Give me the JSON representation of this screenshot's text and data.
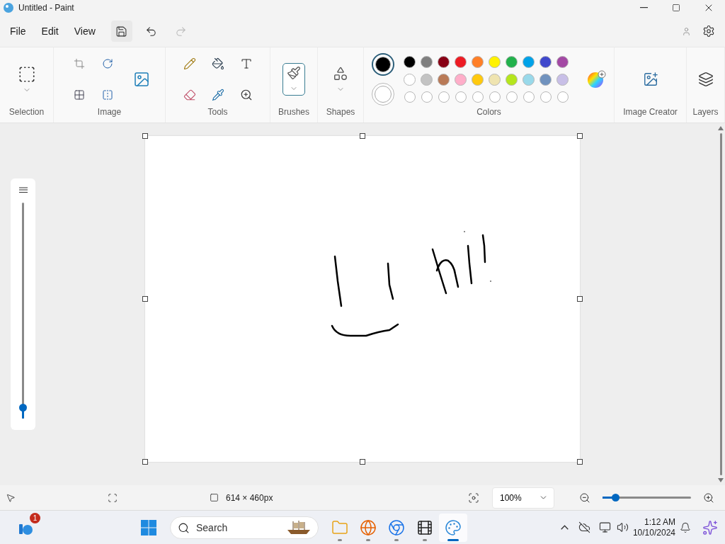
{
  "window": {
    "title": "Untitled - Paint"
  },
  "menu": [
    {
      "label": "File"
    },
    {
      "label": "Edit"
    },
    {
      "label": "View"
    }
  ],
  "ribbon": {
    "groups": [
      {
        "kind": "selection",
        "label": "Selection",
        "selected": false
      },
      {
        "kind": "image",
        "label": "Image"
      },
      {
        "kind": "tools",
        "label": "Tools"
      },
      {
        "kind": "brushes",
        "label": "Brushes",
        "selected": true
      },
      {
        "kind": "shapes",
        "label": "Shapes",
        "selected": false
      },
      {
        "kind": "colors",
        "label": "Colors"
      },
      {
        "kind": "creator",
        "label": "Image Creator"
      },
      {
        "kind": "layers",
        "label": "Layers"
      }
    ],
    "primary_color": {
      "color": "#000000",
      "selected": true
    },
    "secondary_color": {
      "color": "#ffffff",
      "selected": false
    },
    "palette": [
      {
        "color": "#000000"
      },
      {
        "color": "#7f7f7f"
      },
      {
        "color": "#880015"
      },
      {
        "color": "#ed1c24"
      },
      {
        "color": "#ff7f27"
      },
      {
        "color": "#fff200"
      },
      {
        "color": "#22b14c"
      },
      {
        "color": "#00a2e8"
      },
      {
        "color": "#3f48cc"
      },
      {
        "color": "#a349a4"
      },
      {
        "color": "#ffffff"
      },
      {
        "color": "#c3c3c3"
      },
      {
        "color": "#b97a57"
      },
      {
        "color": "#ffaec9"
      },
      {
        "color": "#ffc90e"
      },
      {
        "color": "#efe4b0"
      },
      {
        "color": "#b5e61d"
      },
      {
        "color": "#99d9ea"
      },
      {
        "color": "#7092be"
      },
      {
        "color": "#c8bfe7"
      }
    ]
  },
  "size_slider": {
    "level": 0.05
  },
  "status_bar": {
    "canvas_size": "614 × 460px",
    "zoom": "100%",
    "zoom_slider": {
      "level": 0.14
    }
  },
  "taskbar": {
    "badge": "1",
    "search": {
      "placeholder": "Search"
    },
    "apps": [
      {
        "kind": "files",
        "selected": false
      },
      {
        "kind": "browser",
        "selected": false
      },
      {
        "kind": "chrome",
        "selected": false
      },
      {
        "kind": "editor",
        "selected": false
      },
      {
        "kind": "paint",
        "selected": true
      }
    ],
    "time": "1:12 AM",
    "date": "10/10/2024"
  }
}
